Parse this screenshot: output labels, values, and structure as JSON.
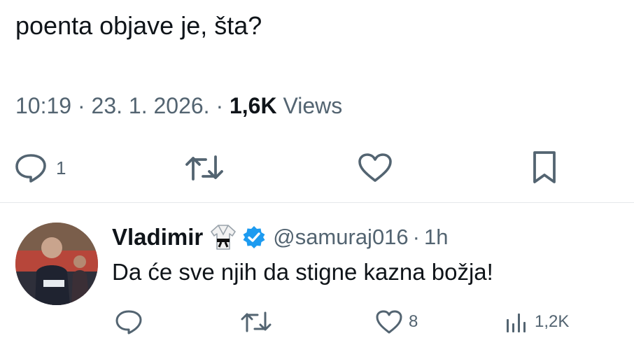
{
  "tweet": {
    "text": "poenta objave je, šta?",
    "time": "10:19",
    "date": "23. 1. 2026.",
    "separator": "·",
    "views_count": "1,6K",
    "views_label": "Views",
    "reply_count": "1"
  },
  "reply": {
    "name": "Vladimir",
    "name_emoji_icon": "martial-arts-uniform-icon",
    "verified_icon": "verified-badge-icon",
    "handle": "@samuraj016",
    "separator": "·",
    "age": "1h",
    "text": "Da će sve njih da stigne kazna božja!",
    "like_count": "8",
    "views_count": "1,2K"
  },
  "colors": {
    "text": "#0f1419",
    "secondary": "#536471",
    "verified": "#1d9bf0",
    "divider": "#e4e7ea"
  }
}
